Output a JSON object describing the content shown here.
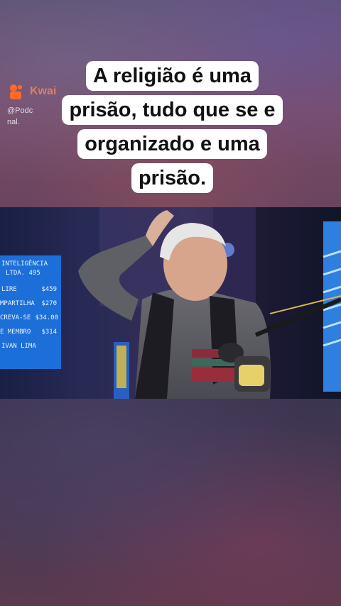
{
  "watermark": {
    "brand": "Kwai",
    "handle_line1": "@Podc",
    "handle_line2": "nal."
  },
  "caption": {
    "lines": [
      "A religião é uma",
      "prisão, tudo que se e",
      "organizado e uma",
      "prisão."
    ]
  },
  "video": {
    "board": {
      "title1": "INTELIGÊNCIA",
      "title2": "LTDA. 495",
      "rows": [
        {
          "label": "LIRE",
          "value": "$459"
        },
        {
          "label": "MPARTILHA",
          "value": "$270"
        },
        {
          "label": "CREVA-SE",
          "value": "$34.00"
        },
        {
          "label": "E MEMBRO",
          "value": "$314"
        }
      ],
      "footer": "IVAN LIMA"
    }
  },
  "colors": {
    "board_blue": "#1c6fd8",
    "board_text": "#e8f4ff",
    "caption_bg": "#ffffff",
    "caption_text": "#111111",
    "watermark_accent": "#ff6a2a"
  }
}
